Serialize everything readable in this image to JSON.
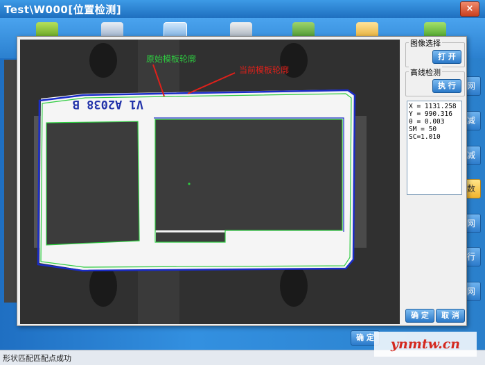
{
  "window": {
    "title": "Test\\W000[位置检测]",
    "close_label": "×"
  },
  "toolbar": {
    "icons": [
      "camera-icon",
      "image-settings-icon",
      "display-icon",
      "calculator-icon",
      "network-icon",
      "folder-icon",
      "back-arrow-icon"
    ]
  },
  "dialog": {
    "annotations": {
      "original": "原始模板轮廓",
      "current": "当前模板轮廓"
    },
    "part_marking": "V1 A2038 B",
    "image_select": {
      "label": "图像选择",
      "open_button": "打 开"
    },
    "high_line": {
      "label": "高线检测",
      "run_button": "执 行"
    },
    "readout": [
      "X = 1131.258",
      "Y = 990.316",
      "θ = 0.003",
      "SM = 50",
      "SC=1.010"
    ],
    "ok_button": "确 定",
    "cancel_button": "取 消"
  },
  "right_buttons": [
    "网",
    "减",
    "减",
    "数",
    "网",
    "行",
    "网"
  ],
  "main_buttons": {
    "ok": "确 定"
  },
  "status": {
    "text": "形状匹配匹配点成功"
  },
  "watermark": {
    "text": "ynmtw.cn"
  },
  "colors": {
    "accent": "#2a7fc8",
    "green_contour": "#2ecc40",
    "blue_contour": "#1a2cc8",
    "red_annotation": "#e0201a"
  }
}
